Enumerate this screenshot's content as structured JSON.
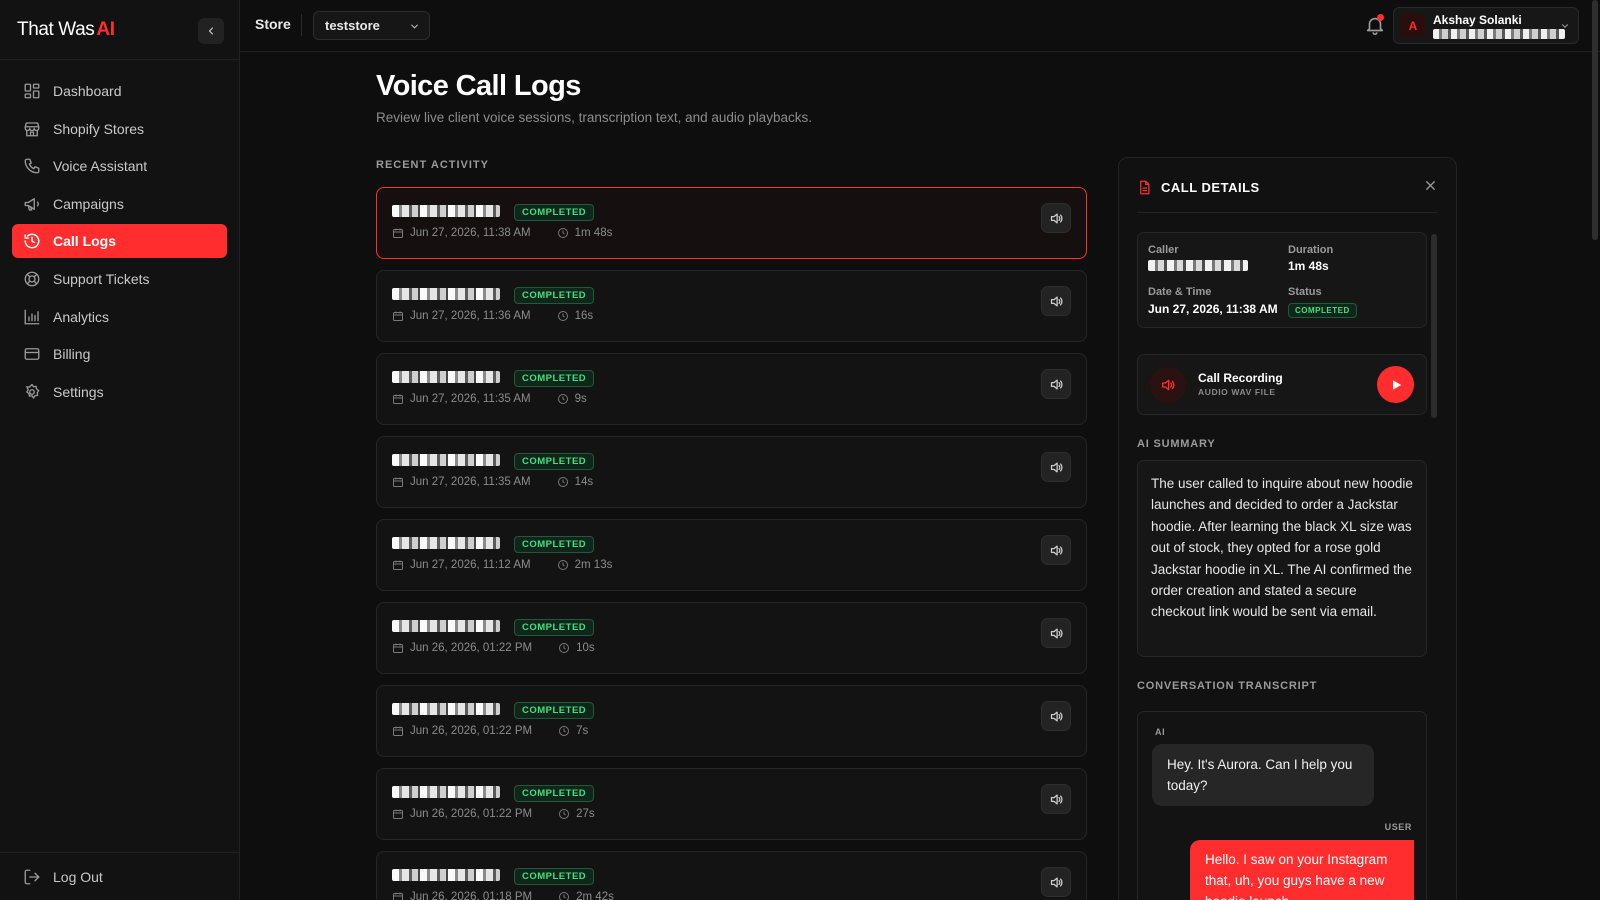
{
  "brand": {
    "name": "That Was",
    "accent": "AI"
  },
  "sidebar": {
    "items": [
      {
        "label": "Dashboard",
        "icon": "dashboard-icon"
      },
      {
        "label": "Shopify Stores",
        "icon": "store-icon"
      },
      {
        "label": "Voice Assistant",
        "icon": "phone-icon"
      },
      {
        "label": "Campaigns",
        "icon": "megaphone-icon"
      },
      {
        "label": "Call Logs",
        "icon": "history-icon",
        "active": true
      },
      {
        "label": "Support Tickets",
        "icon": "lifebuoy-icon"
      },
      {
        "label": "Analytics",
        "icon": "bar-chart-icon"
      },
      {
        "label": "Billing",
        "icon": "credit-card-icon"
      },
      {
        "label": "Settings",
        "icon": "gear-icon"
      }
    ],
    "logout": "Log Out"
  },
  "topbar": {
    "store_label": "Store",
    "store_value": "teststore",
    "user_name": "Akshay Solanki",
    "user_initial": "A"
  },
  "page": {
    "title": "Voice Call Logs",
    "subtitle": "Review live client voice sessions, transcription text, and audio playbacks.",
    "section": "RECENT ACTIVITY"
  },
  "calls": [
    {
      "status": "COMPLETED",
      "date": "Jun 27, 2026, 11:38 AM",
      "duration": "1m 48s"
    },
    {
      "status": "COMPLETED",
      "date": "Jun 27, 2026, 11:36 AM",
      "duration": "16s"
    },
    {
      "status": "COMPLETED",
      "date": "Jun 27, 2026, 11:35 AM",
      "duration": "9s"
    },
    {
      "status": "COMPLETED",
      "date": "Jun 27, 2026, 11:35 AM",
      "duration": "14s"
    },
    {
      "status": "COMPLETED",
      "date": "Jun 27, 2026, 11:12 AM",
      "duration": "2m 13s"
    },
    {
      "status": "COMPLETED",
      "date": "Jun 26, 2026, 01:22 PM",
      "duration": "10s"
    },
    {
      "status": "COMPLETED",
      "date": "Jun 26, 2026, 01:22 PM",
      "duration": "7s"
    },
    {
      "status": "COMPLETED",
      "date": "Jun 26, 2026, 01:22 PM",
      "duration": "27s"
    },
    {
      "status": "COMPLETED",
      "date": "Jun 26, 2026, 01:18 PM",
      "duration": "2m 42s"
    }
  ],
  "details": {
    "title": "CALL DETAILS",
    "caller_label": "Caller",
    "duration_label": "Duration",
    "duration_value": "1m 48s",
    "datetime_label": "Date & Time",
    "datetime_value": "Jun 27, 2026, 11:38 AM",
    "status_label": "Status",
    "status_value": "COMPLETED",
    "recording_title": "Call Recording",
    "recording_sub": "AUDIO WAV FILE",
    "summary_label": "AI SUMMARY",
    "summary_text": "The user called to inquire about new hoodie launches and decided to order a Jackstar hoodie. After learning the black XL size was out of stock, they opted for a rose gold Jackstar hoodie in XL. The AI confirmed the order creation and stated a secure checkout link would be sent via email.",
    "transcript_label": "CONVERSATION TRANSCRIPT",
    "transcript": [
      {
        "role": "AI",
        "text": "Hey. It's Aurora. Can I help you today?"
      },
      {
        "role": "USER",
        "text": "Hello. I saw on your Instagram that, uh, you guys have a new hoodie launch"
      }
    ]
  },
  "colors": {
    "accent": "#ff2d2d",
    "success": "#3ee081",
    "background": "#0e0e0e"
  }
}
